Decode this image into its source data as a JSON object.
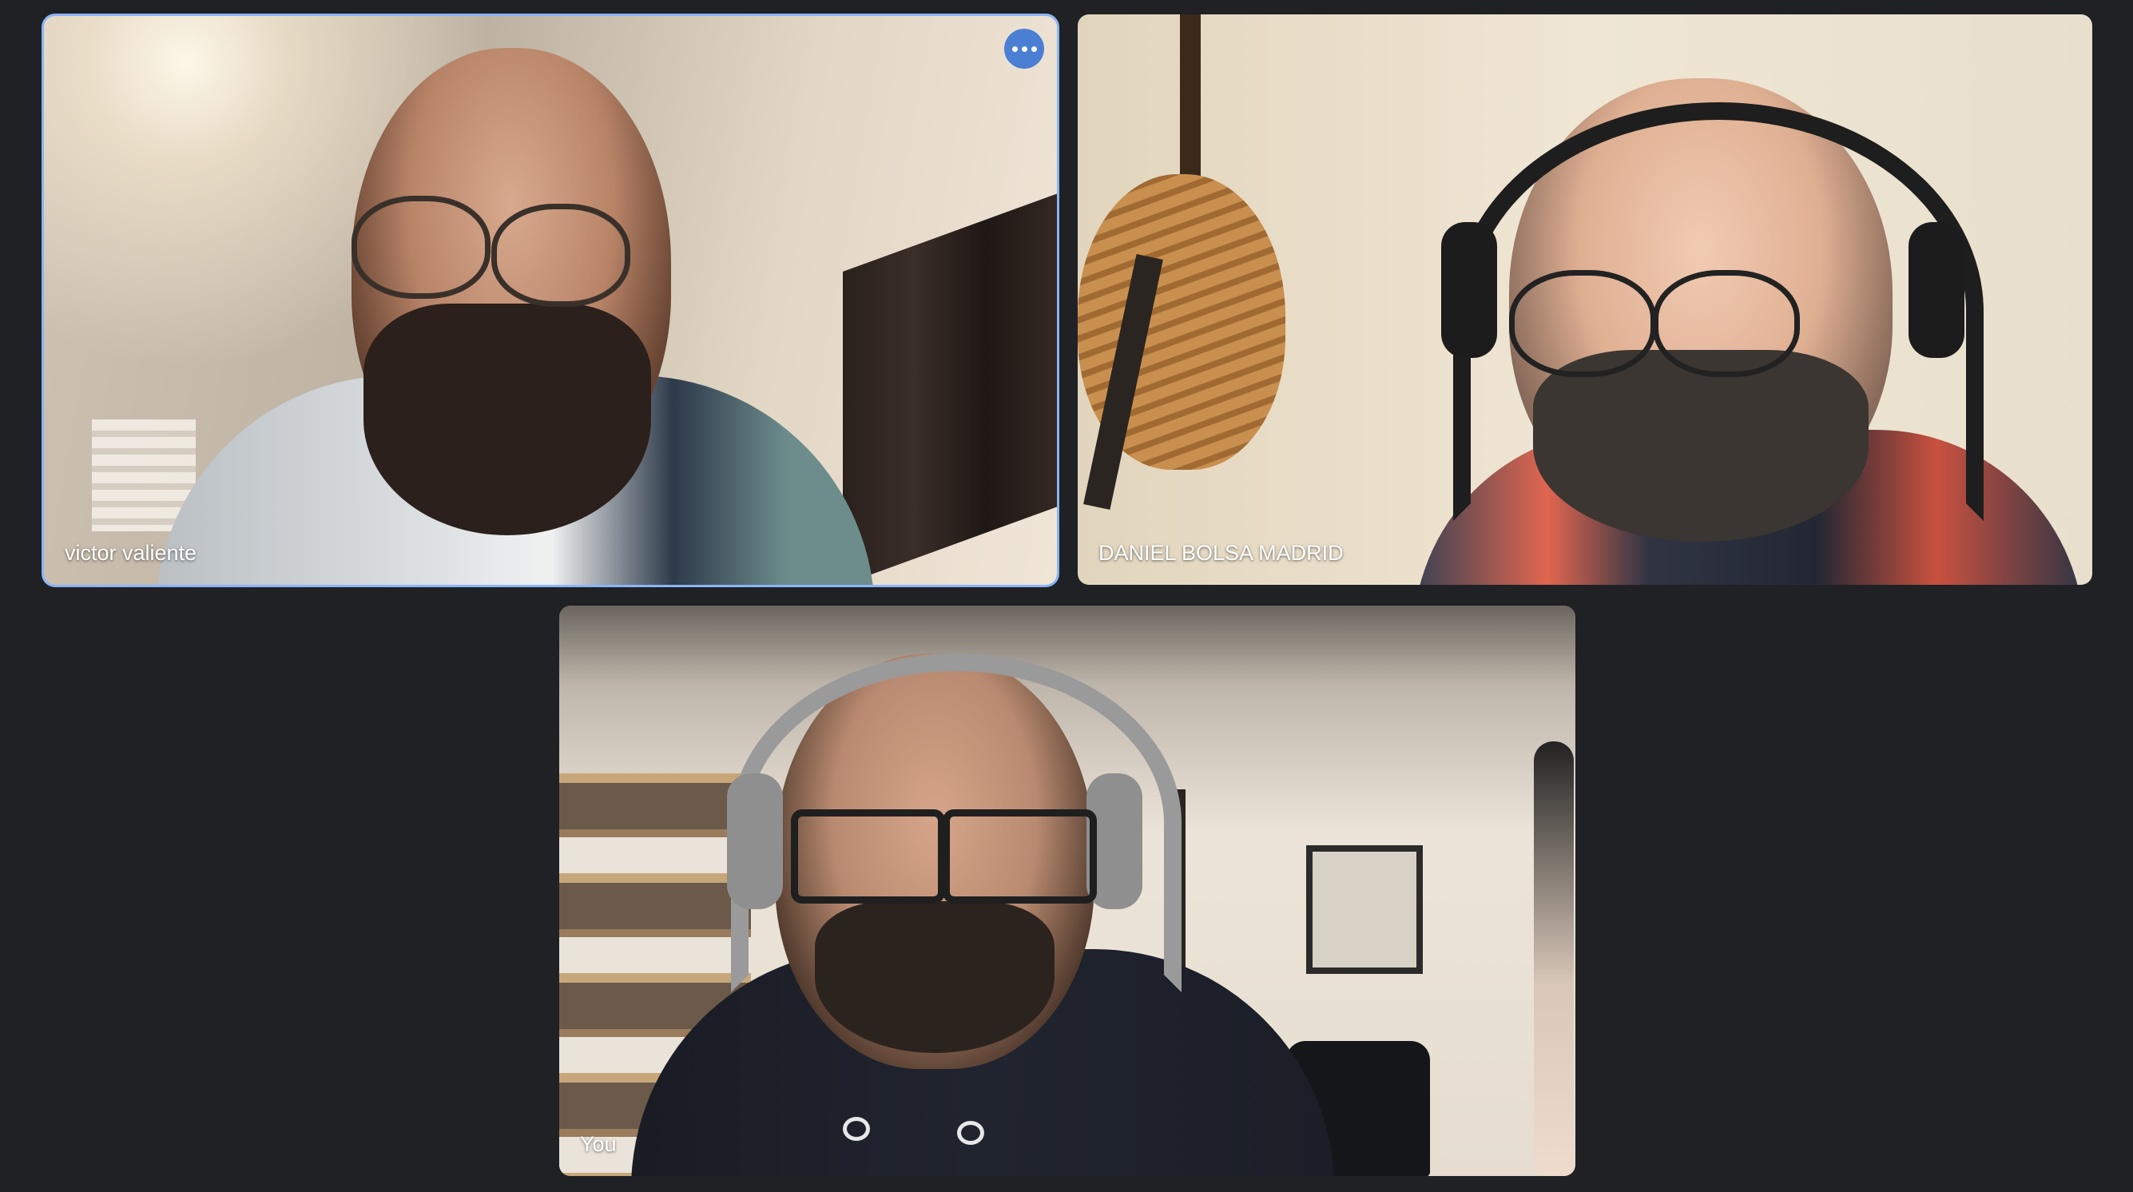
{
  "participants": [
    {
      "name": "victor valiente",
      "active_speaker": true
    },
    {
      "name": "DANIEL BOLSA MADRID",
      "active_speaker": false
    },
    {
      "name": "You",
      "active_speaker": false
    }
  ],
  "controls": {
    "more_options_icon": "more-horiz-icon"
  },
  "colors": {
    "background": "#202124",
    "active_outline": "#8ab4f8",
    "more_button": "#4a7fd4"
  }
}
